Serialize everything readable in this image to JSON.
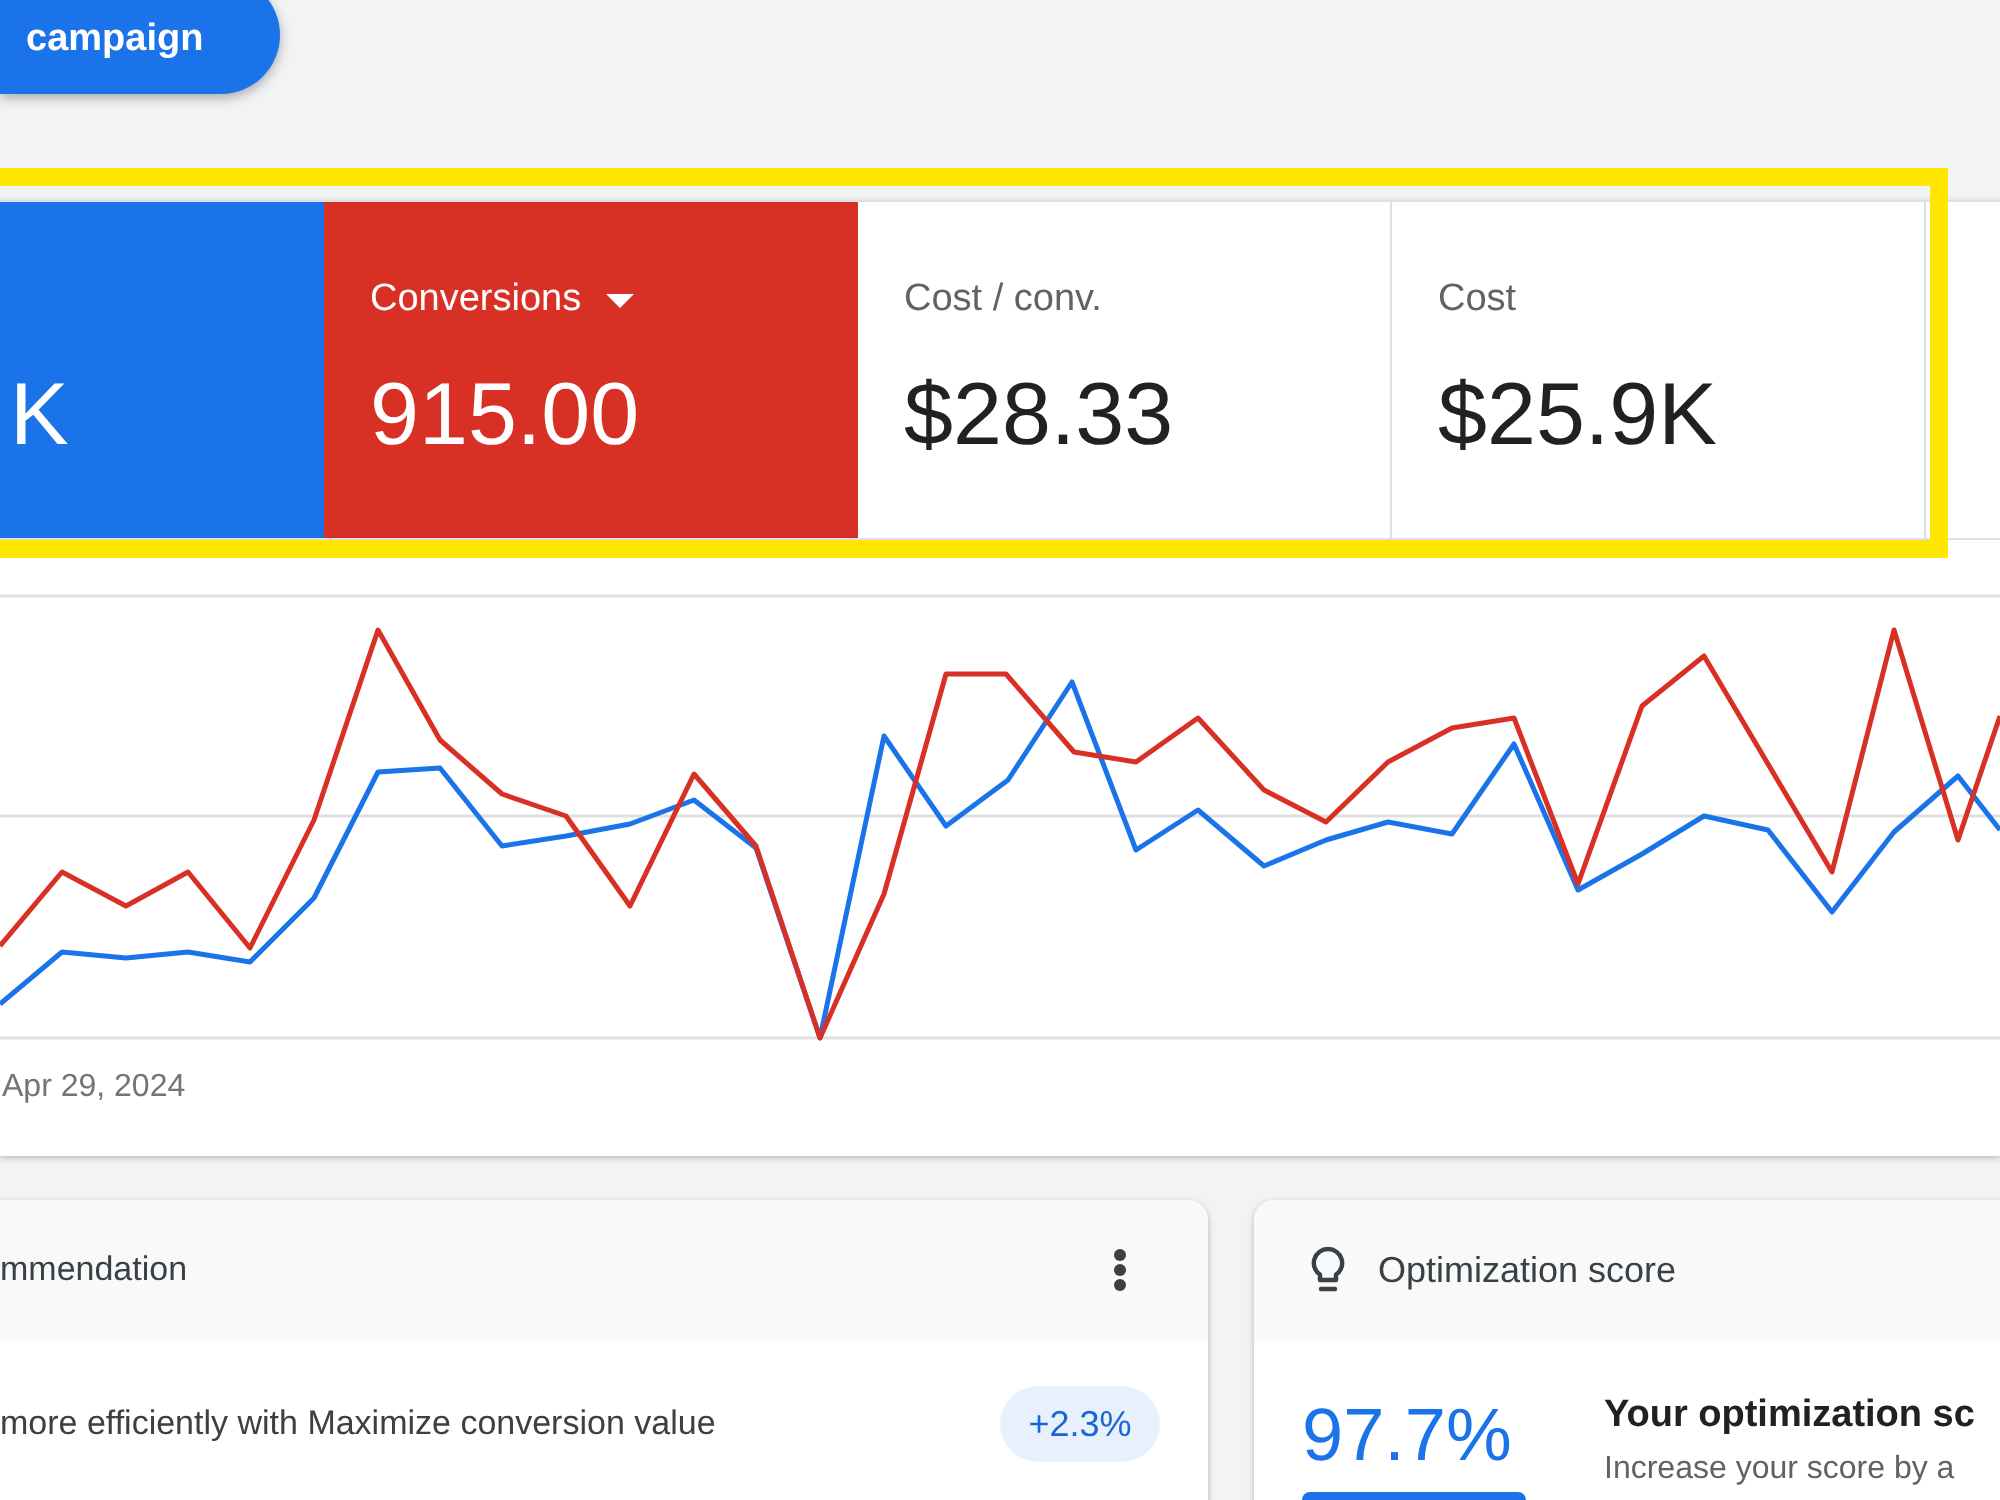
{
  "header": {
    "button": "campaign"
  },
  "metrics": [
    {
      "value": "K",
      "selected": true,
      "color": "#1a73e8"
    },
    {
      "label": "Conversions",
      "value": "915.00",
      "selected": true,
      "color": "#d93025",
      "dropdown": true
    },
    {
      "label": "Cost / conv.",
      "value": "$28.33",
      "selected": false,
      "dropdown": false
    },
    {
      "label": "Cost",
      "value": "$25.9K",
      "selected": false,
      "dropdown": false
    }
  ],
  "chart": {
    "x_label": "Apr 29, 2024"
  },
  "recommendation_card": {
    "title": "mmendation",
    "text": "more efficiently with Maximize conversion value",
    "badge": "+2.3%"
  },
  "optimization_card": {
    "title": "Optimization score",
    "score": "97.7%",
    "heading": "Your optimization sc",
    "subtext": "Increase your score by a"
  }
}
